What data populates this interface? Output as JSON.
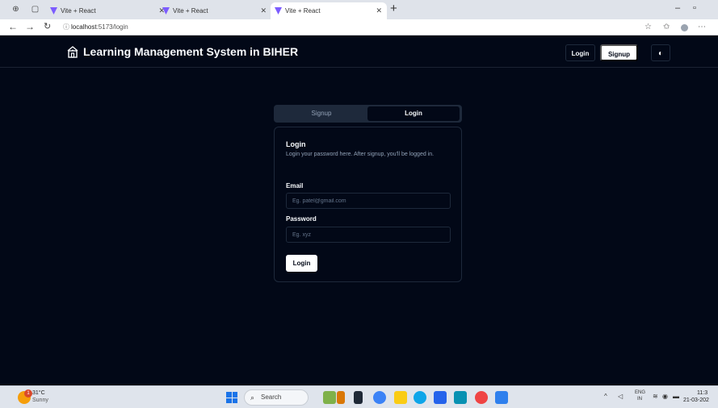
{
  "browser": {
    "tabs": [
      {
        "title": "Vite + React",
        "active": false
      },
      {
        "title": "Vite + React",
        "active": false
      },
      {
        "title": "Vite + React",
        "active": true
      }
    ],
    "url_host": "localhost",
    "url_path": ":5173/login",
    "icons": {
      "workspaces": "workspaces-icon",
      "tab_actions": "tab-actions-icon",
      "favicon": "vite-logo-icon"
    },
    "colors": {
      "favicon": "#7c5cff",
      "tabbar": "#dfe3ea"
    }
  },
  "header": {
    "title": "Learning Management System in BIHER",
    "login_label": "Login",
    "signup_label": "Signup",
    "theme_icon": "theme-toggle-icon"
  },
  "auth": {
    "tabs": {
      "signup": "Signup",
      "login": "Login"
    },
    "active_tab": "login",
    "card_title": "Login",
    "card_description": "Login your password here. After signup, you'll be logged in.",
    "email_label": "Email",
    "email_placeholder": "Eg. patel@gmail.com",
    "password_label": "Password",
    "password_placeholder": "Eg. xyz",
    "submit_label": "Login"
  },
  "taskbar": {
    "weather_temp": "31°C",
    "weather_condition": "Sunny",
    "weather_badge": "1",
    "search_label": "Search",
    "lang_top": "ENG",
    "lang_bottom": "IN",
    "time": "11:3",
    "date": "21-03-202"
  },
  "theme": {
    "background": "#020817",
    "foreground": "#f8fafc",
    "muted": "#94a3b8",
    "border": "#1e293b"
  }
}
